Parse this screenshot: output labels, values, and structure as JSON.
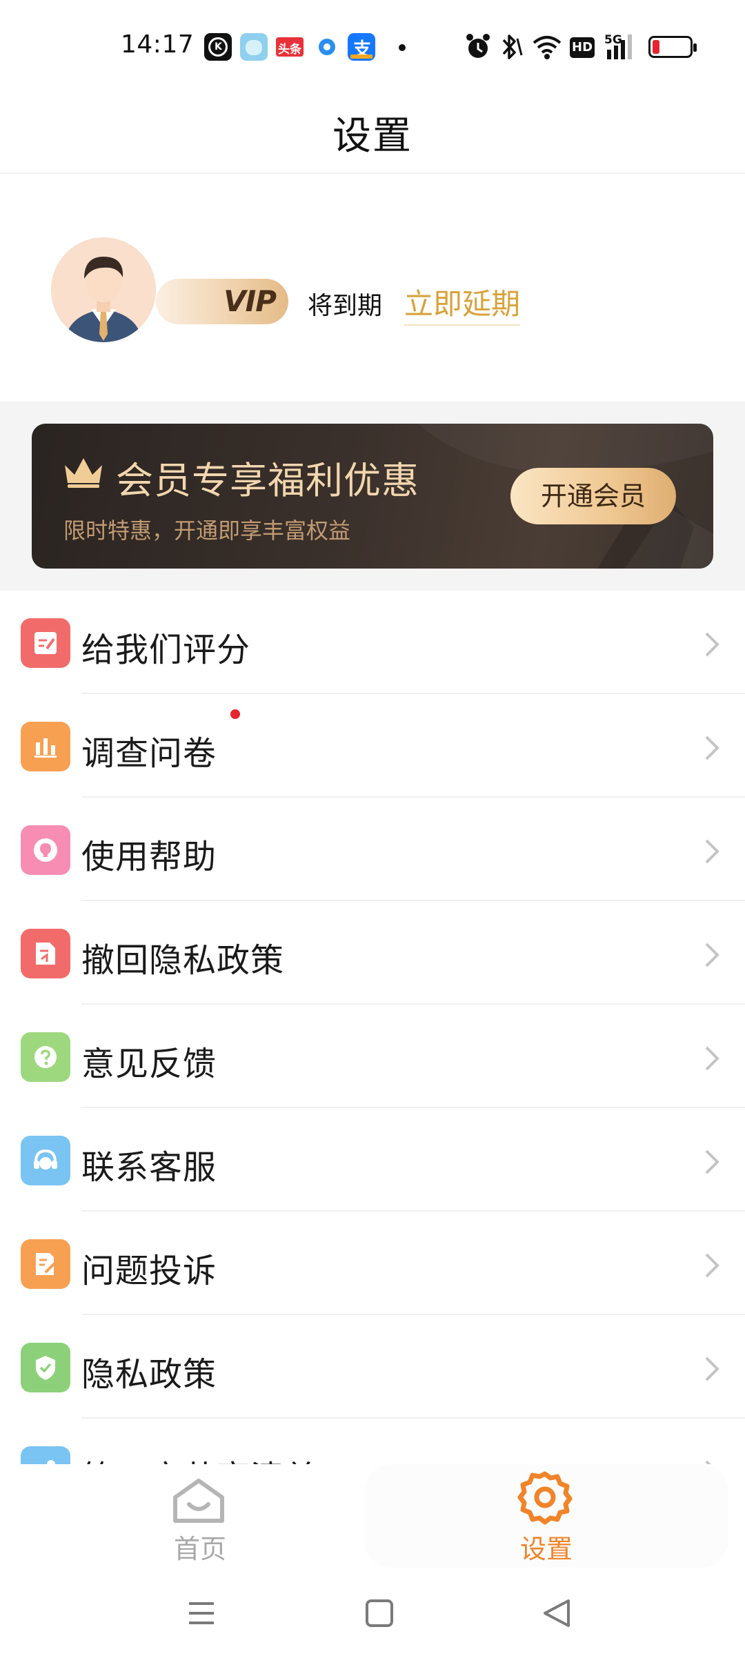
{
  "status_bar": {
    "time": "14:17",
    "app_icons": [
      "kk-app-icon",
      "bear-app-icon",
      "toutiao-app-icon",
      "circle-app-icon",
      "alipay-app-icon"
    ],
    "toutiao_text": "头条",
    "alipay_text": "支",
    "network_text": "5G",
    "hd_text": "HD",
    "battery_color": "#e5262e"
  },
  "header": {
    "title": "设置"
  },
  "profile": {
    "vip_badge": "VIP",
    "expire_text": "将到期",
    "renew_link": "立即延期",
    "accent_color": "#d8a23a"
  },
  "banner": {
    "title": "会员专享福利优惠",
    "subtitle": "限时特惠，开通即享丰富权益",
    "button": "开通会员"
  },
  "menu": {
    "items": [
      {
        "label": "给我们评分",
        "icon": "rate-icon",
        "color": "#f26b6b"
      },
      {
        "label": "调查问卷",
        "icon": "survey-icon",
        "color": "#f8a052",
        "badge": "new"
      },
      {
        "label": "使用帮助",
        "icon": "help-bulb-icon",
        "color": "#f78db3"
      },
      {
        "label": "撤回隐私政策",
        "icon": "revoke-privacy-icon",
        "color": "#f26b6b"
      },
      {
        "label": "意见反馈",
        "icon": "feedback-icon",
        "color": "#9ed87e"
      },
      {
        "label": "联系客服",
        "icon": "customer-service-icon",
        "color": "#79c4f2"
      },
      {
        "label": "问题投诉",
        "icon": "complaint-icon",
        "color": "#f8a052"
      },
      {
        "label": "隐私政策",
        "icon": "privacy-shield-icon",
        "color": "#8cd17a"
      },
      {
        "label": "第三方共享清单",
        "icon": "share-list-icon",
        "color": "#79c4f2"
      }
    ]
  },
  "tabbar": {
    "tabs": [
      {
        "label": "首页",
        "icon": "home-icon",
        "active": false
      },
      {
        "label": "设置",
        "icon": "settings-gear-icon",
        "active": true
      }
    ],
    "active_color": "#f0842a"
  },
  "navbar": {
    "buttons": [
      "menu-icon",
      "home-square-icon",
      "back-triangle-icon"
    ]
  }
}
